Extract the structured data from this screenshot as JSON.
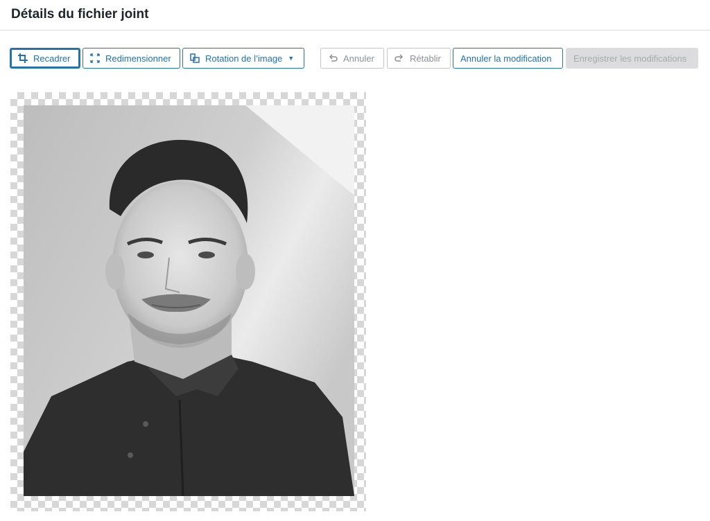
{
  "header": {
    "title": "Détails du fichier joint"
  },
  "toolbar": {
    "crop_label": "Recadrer",
    "resize_label": "Redimensionner",
    "rotate_label": "Rotation de l’image",
    "undo_label": "Annuler",
    "redo_label": "Rétablir",
    "cancel_edit_label": "Annuler la modification",
    "save_label": "Enregistrer les modifications"
  },
  "icons": {
    "crop": "crop-icon",
    "resize": "resize-icon",
    "rotate": "rotate-icon",
    "undo": "undo-icon",
    "redo": "redo-icon",
    "dropdown": "chevron-down-icon"
  },
  "colors": {
    "accent": "#2271b1",
    "disabled_bg": "#dcdcde",
    "border": "#dcdcde",
    "text": "#1d2327"
  }
}
